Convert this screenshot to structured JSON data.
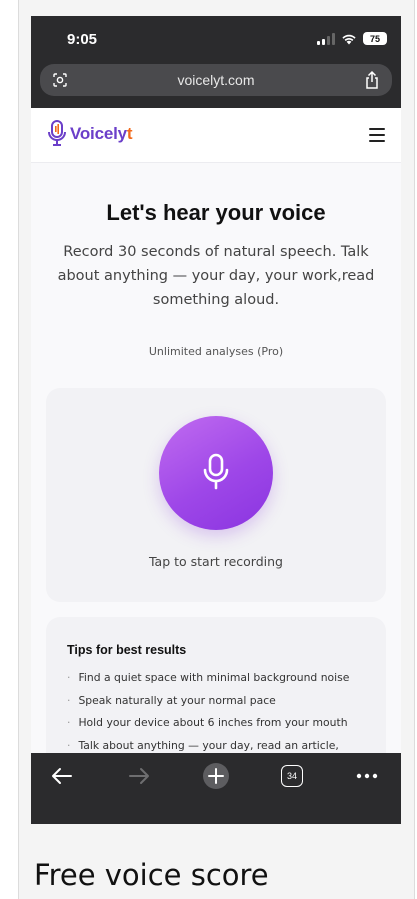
{
  "status_bar": {
    "time": "9:05",
    "battery": "75"
  },
  "browser": {
    "url": "voicelyt.com",
    "tabs_count": "34"
  },
  "site": {
    "logo_name": "Voicely",
    "logo_tail": "t",
    "brand_color": "#6b3fc9",
    "accent_color": "#f26a1b"
  },
  "main": {
    "heading": "Let's hear your voice",
    "lead": "Record 30 seconds of natural speech. Talk about anything — your day, your work,read something aloud.",
    "quota": "Unlimited analyses (Pro)",
    "record_label": "Tap to start recording",
    "record_color": "#a34ae8"
  },
  "tips": {
    "title": "Tips for best results",
    "items": [
      "Find a quiet space with minimal background noise",
      "Speak naturally at your normal pace",
      "Hold your device about 6 inches from your mouth",
      "Talk about anything — your day, read an article,"
    ]
  },
  "caption": "Free voice score",
  "icons": [
    "lens-icon",
    "share-icon",
    "menu-icon",
    "microphone-icon",
    "back-arrow-icon",
    "forward-arrow-icon",
    "new-tab-plus-icon",
    "tabs-count-icon",
    "more-icon"
  ]
}
